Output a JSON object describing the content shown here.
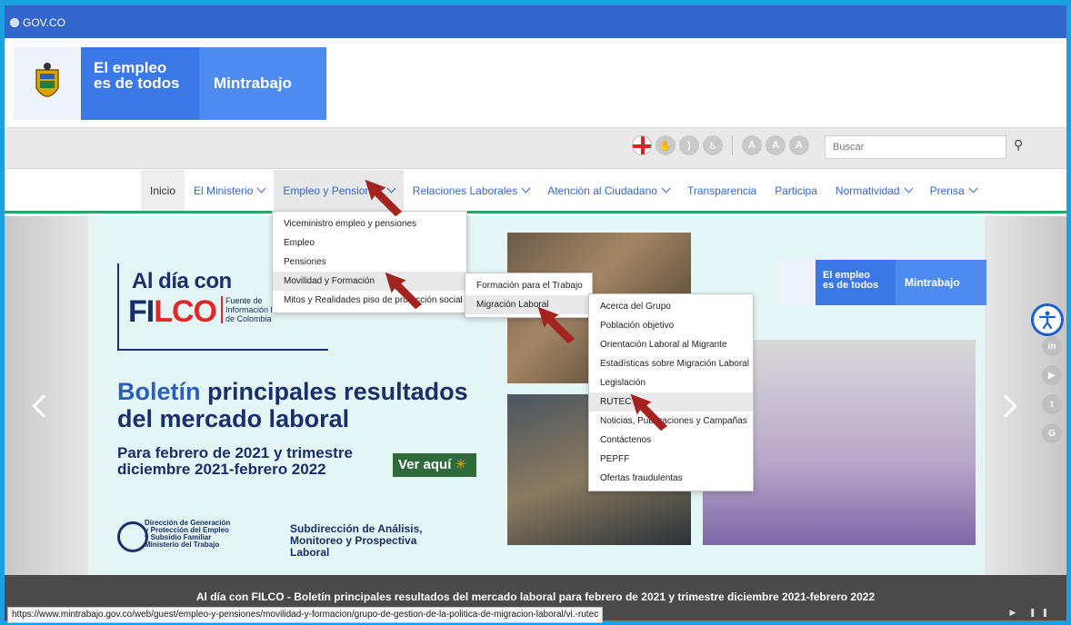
{
  "gov_bar": {
    "label": "GOV.CO"
  },
  "header": {
    "brand_line1": "El empleo",
    "brand_line2": "es de todos",
    "ministry": "Mintrabajo"
  },
  "toolbar": {
    "icons": [
      "uk-flag-icon",
      "sign-language-icon",
      "rss-icon",
      "wheelchair-icon",
      "font-decrease-icon",
      "font-normal-icon",
      "font-increase-icon"
    ],
    "font_a": "A",
    "search_placeholder": "Buscar",
    "search_icon": "search-icon"
  },
  "nav": {
    "items": [
      {
        "label": "Inicio"
      },
      {
        "label": "El Ministerio"
      },
      {
        "label": "Empleo y Pensiones"
      },
      {
        "label": "Relaciones Laborales"
      },
      {
        "label": "Atención al Ciudadano"
      },
      {
        "label": "Transparencia"
      },
      {
        "label": "Participa"
      },
      {
        "label": "Normatividad"
      },
      {
        "label": "Prensa"
      }
    ]
  },
  "menu_empleo": {
    "items": [
      {
        "label": "Viceministro empleo y pensiones"
      },
      {
        "label": "Empleo"
      },
      {
        "label": "Pensiones"
      },
      {
        "label": "Movilidad y Formación"
      },
      {
        "label": "Mitos y Realidades piso de protección social"
      }
    ]
  },
  "menu_movilidad": {
    "items": [
      {
        "label": "Formación para el Trabajo"
      },
      {
        "label": "Migración Laboral"
      }
    ]
  },
  "menu_migracion": {
    "items": [
      {
        "label": "Acerca del Grupo"
      },
      {
        "label": "Población objetivo"
      },
      {
        "label": "Orientación Laboral al Migrante"
      },
      {
        "label": "Estadísticas sobre Migración Laboral"
      },
      {
        "label": "Legislación"
      },
      {
        "label": "RUTEC"
      },
      {
        "label": "Noticias, Publicaciones y Campañas"
      },
      {
        "label": "Contáctenos"
      },
      {
        "label": "PEPFF"
      },
      {
        "label": "Ofertas fraudulentas"
      }
    ]
  },
  "hero": {
    "al_dia": "Al día con",
    "filco_fi": "FI",
    "filco_lco": "LCO",
    "filco_sub1": "Fuente de",
    "filco_sub2": "Información Laboral",
    "filco_sub3": "de Colombia",
    "title_bold": "Boletín",
    "title_rest": " principales resultados",
    "title_line2": "del mercado laboral",
    "subtitle_line1": "Para febrero de 2021 y trimestre",
    "subtitle_line2": "diciembre 2021-febrero 2022",
    "cta": "Ver aquí",
    "logo_dir_1": "Dirección de Generación",
    "logo_dir_2": "y Protección del Empleo",
    "logo_dir_3": "y Subsidio Familiar",
    "logo_dir_4": "Ministerio del Trabajo",
    "logo_sub_1": "Subdirección de Análisis,",
    "logo_sub_2": "Monitoreo y Prospectiva Laboral",
    "brand_line1": "El empleo",
    "brand_line2": "es de todos",
    "ministry": "Mintrabajo"
  },
  "social": {
    "items": [
      {
        "label": "in",
        "icon": "linkedin-icon"
      },
      {
        "label": "▶",
        "icon": "youtube-icon"
      },
      {
        "label": "t",
        "icon": "twitter-icon"
      },
      {
        "label": "G",
        "icon": "google-icon"
      }
    ],
    "accessibility_icon": "accessibility-icon"
  },
  "caption": {
    "text": "Al día con FILCO - Boletín principales resultados del mercado laboral para febrero de 2021 y trimestre diciembre 2021-febrero 2022",
    "controls": "▶ ❚❚"
  },
  "status_url": "https://www.mintrabajo.gov.co/web/guest/empleo-y-pensiones/movilidad-y-formacion/grupo-de-gestion-de-la-politica-de-migracion-laboral/vi.-rutec",
  "colors": {
    "gov_blue": "#3366cc",
    "frame_cyan": "#1ea0e0",
    "brand_blue": "#3a78e6",
    "nav_green": "#2fa36b",
    "pointer_red": "#a3231f",
    "filco_navy": "#1a2e6a"
  }
}
